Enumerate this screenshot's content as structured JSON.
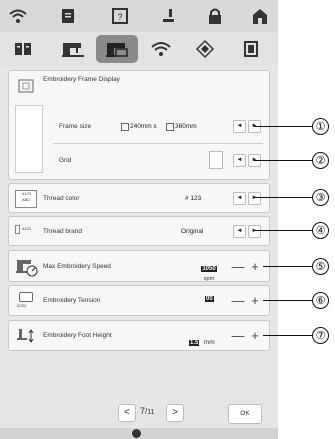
{
  "frame_display": {
    "title": "Embroidery Frame Display",
    "frame_size_label": "Frame size",
    "frame_size_value_w": "240mm x",
    "frame_size_value_h": "360mm",
    "grid_label": "Grid"
  },
  "thread_color": {
    "label": "Thread color",
    "value": "# 123",
    "icon_text_1": "#123",
    "icon_text_2": "ABC"
  },
  "thread_brand": {
    "label": "Thread brand",
    "value": "Original",
    "icon_text": "#123"
  },
  "max_speed": {
    "label": "Max Embroidery Speed",
    "value": "1050",
    "unit": "spm"
  },
  "tension": {
    "label": "Embroidery Tension",
    "value": "00",
    "icon_text": "ICON"
  },
  "foot_height": {
    "label": "Embroidery Foot Height",
    "value": "1.5",
    "unit": "mm"
  },
  "controls": {
    "prev": "◄",
    "next": "►",
    "minus": "—",
    "plus": "+"
  },
  "pagination": {
    "prev": "<",
    "next": ">",
    "current": "7",
    "total": "11",
    "ok": "OK"
  },
  "callouts": [
    "①",
    "②",
    "③",
    "④",
    "⑤",
    "⑥",
    "⑦"
  ]
}
